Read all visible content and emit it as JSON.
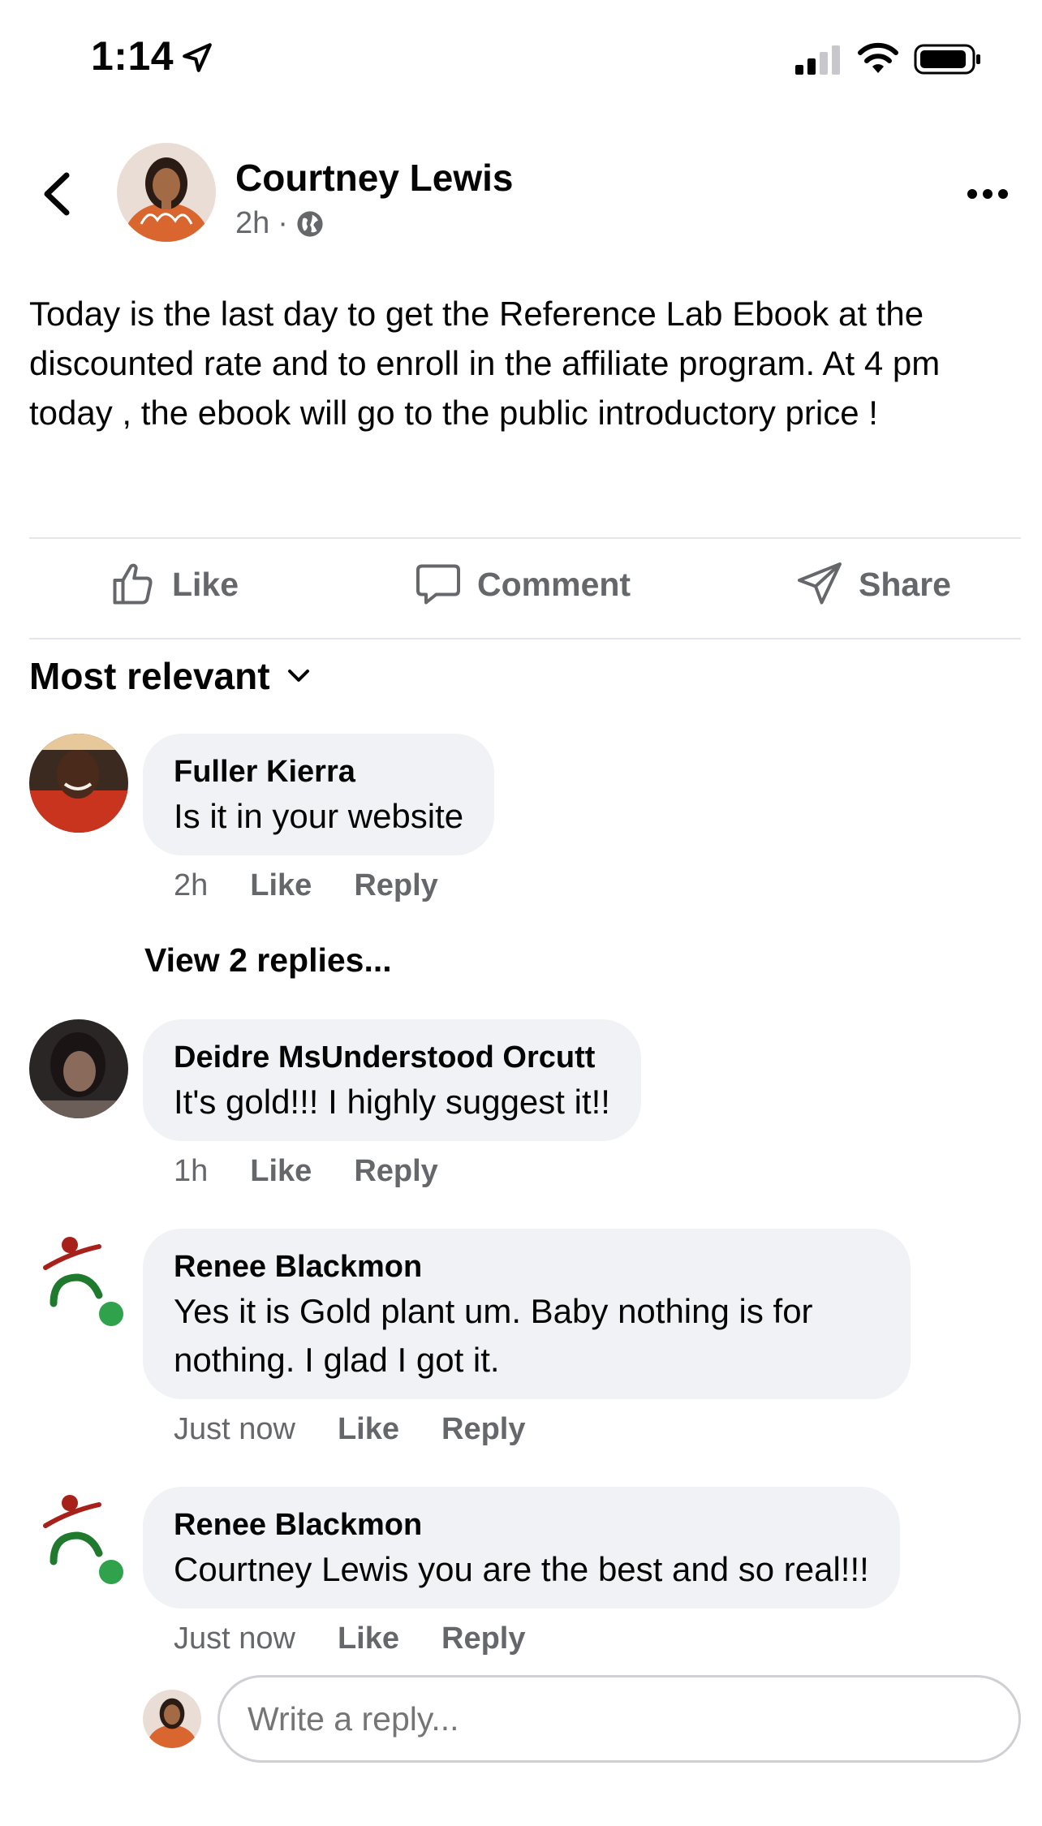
{
  "status_bar": {
    "time": "1:14"
  },
  "post": {
    "author": "Courtney Lewis",
    "time": "2h",
    "separator": "·",
    "text": "Today is the last day to get the Reference Lab Ebook at the discounted rate and to enroll in the affiliate program. At 4 pm today , the ebook will go to the public introductory price !"
  },
  "actions": {
    "like": "Like",
    "comment": "Comment",
    "share": "Share"
  },
  "sort_label": "Most relevant",
  "comments": [
    {
      "name": "Fuller Kierra",
      "text": "Is it in your website",
      "time": "2h",
      "like": "Like",
      "reply": "Reply"
    },
    {
      "name": "Deidre MsUnderstood Orcutt",
      "text": "It's gold!!! I highly suggest it!!",
      "time": "1h",
      "like": "Like",
      "reply": "Reply"
    },
    {
      "name": "Renee Blackmon",
      "text": "Yes it is Gold plant um. Baby nothing is for nothing. I glad I got it.",
      "time": "Just now",
      "like": "Like",
      "reply": "Reply"
    },
    {
      "name": "Renee Blackmon",
      "text": "Courtney Lewis you are the best and so real!!!",
      "time": "Just now",
      "like": "Like",
      "reply": "Reply"
    }
  ],
  "view_replies": "View 2 replies...",
  "reply_box": {
    "placeholder": "Write a reply..."
  },
  "colors": {
    "secondary_text": "#65676b",
    "bubble": "#f0f2f5",
    "online": "#31a24c",
    "divider": "#e4e6eb"
  },
  "icons": [
    "location-arrow-icon",
    "signal-icon",
    "wifi-icon",
    "battery-icon",
    "back-chevron-icon",
    "more-icon",
    "globe-icon",
    "like-icon",
    "comment-icon",
    "share-icon",
    "chevron-down-icon"
  ]
}
